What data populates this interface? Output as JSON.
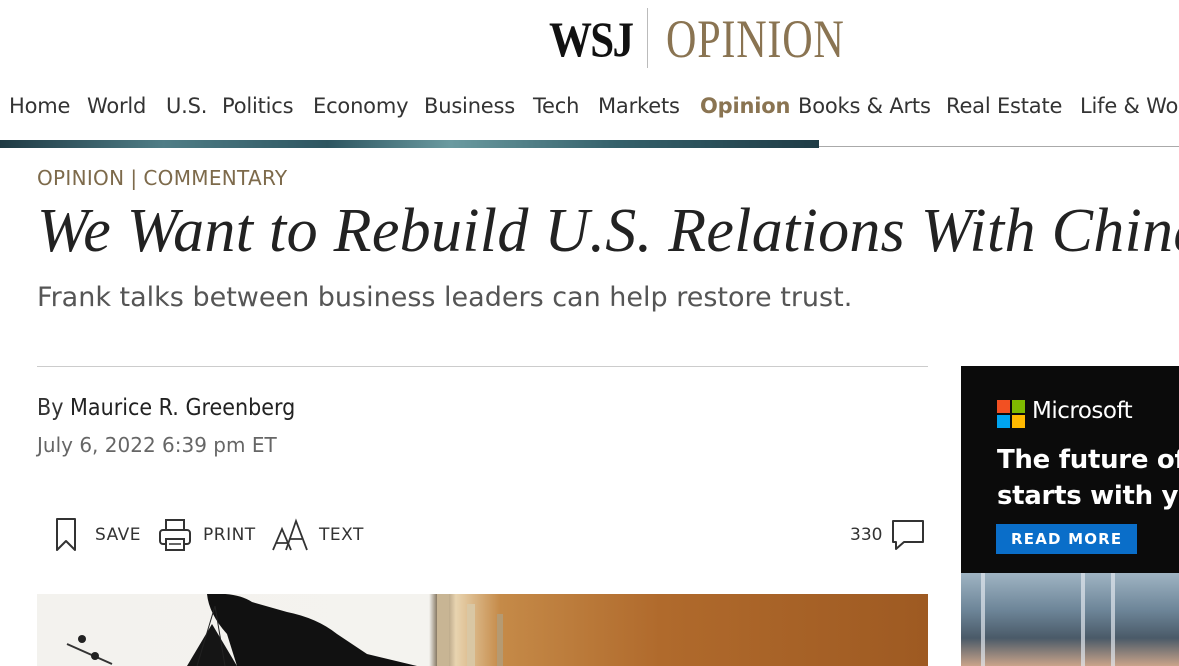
{
  "masthead": {
    "brand": "WSJ",
    "section": "OPINION"
  },
  "nav": {
    "items": [
      {
        "label": "Home",
        "active": false
      },
      {
        "label": "World",
        "active": false
      },
      {
        "label": "U.S.",
        "active": false
      },
      {
        "label": "Politics",
        "active": false
      },
      {
        "label": "Economy",
        "active": false
      },
      {
        "label": "Business",
        "active": false
      },
      {
        "label": "Tech",
        "active": false
      },
      {
        "label": "Markets",
        "active": false
      },
      {
        "label": "Opinion",
        "active": true
      },
      {
        "label": "Books & Arts",
        "active": false
      },
      {
        "label": "Real Estate",
        "active": false
      },
      {
        "label": "Life & Wo",
        "active": false
      }
    ]
  },
  "article": {
    "flag": {
      "section": "OPINION",
      "separator": "|",
      "subsection": "COMMENTARY"
    },
    "headline": "We Want to Rebuild U.S. Relations With China",
    "dek": "Frank talks between business leaders can help restore trust.",
    "byline": {
      "prefix": "By",
      "author": "Maurice R. Greenberg"
    },
    "date": "July 6, 2022 6:39 pm ET",
    "tools": {
      "save_label": "SAVE",
      "print_label": "PRINT",
      "text_label": "TEXT",
      "comment_count": "330"
    }
  },
  "ad": {
    "brand": "Microsoft",
    "copy_line1": "The future of",
    "copy_line2": "starts with yo",
    "cta": "READ MORE",
    "logo_colors": [
      "#f25022",
      "#7fba00",
      "#00a4ef",
      "#ffb900"
    ]
  },
  "colors": {
    "accent": "#8a7452",
    "cta_blue": "#0a6ec9"
  }
}
